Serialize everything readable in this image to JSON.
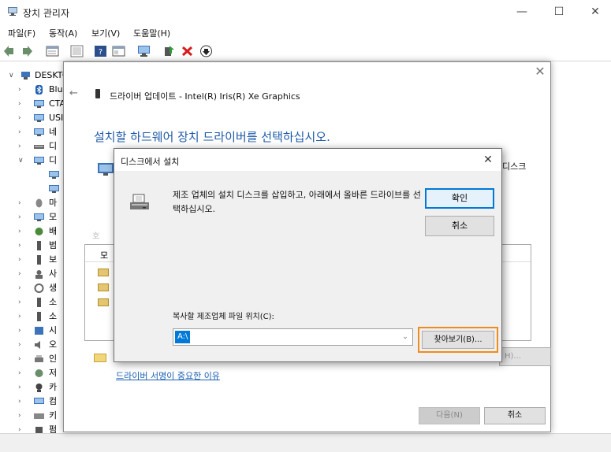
{
  "window": {
    "title": "장치 관리자",
    "controls": {
      "minimize": "—",
      "maximize": "☐",
      "close": "✕"
    }
  },
  "menu": [
    "파일(F)",
    "동작(A)",
    "보기(V)",
    "도움말(H)"
  ],
  "toolbar": [
    "back-icon",
    "forward-icon",
    "properties-icon",
    "view-icon",
    "help-icon",
    "view2-icon",
    "monitor-icon",
    "update-driver-icon",
    "uninstall-icon",
    "download-icon"
  ],
  "tree": {
    "root": "DESKTC",
    "items": [
      "Blu",
      "CTA",
      "USI",
      "네",
      "디",
      "디",
      "",
      "",
      "마",
      "모",
      "배",
      "범",
      "보",
      "사",
      "생",
      "소",
      "소",
      "시",
      "오",
      "인",
      "저",
      "카",
      "컴",
      "키",
      "펌"
    ]
  },
  "wizard": {
    "close": "✕",
    "back": "←",
    "title": "드라이버 업데이트 - Intel(R) Iris(R) Xe Graphics",
    "heading": "설치할 하드웨어 장치 드라이버를 선택하십시오.",
    "side_text": "디스크",
    "compat_text": "호",
    "list_header": "모",
    "have_disk": "H)...",
    "link": "드라이버 서명이 중요한 이유",
    "next": "다음(N)",
    "cancel": "취소"
  },
  "dialog": {
    "title": "디스크에서 설치",
    "close": "✕",
    "message": "제조 업체의 설치 디스크를 삽입하고, 아래에서 올바른 드라이브를 선택하십시오.",
    "ok": "확인",
    "cancel": "취소",
    "path_label": "복사할 제조업체 파일 위치(C):",
    "path_value": "A:\\",
    "browse": "찾아보기(B)..."
  },
  "colors": {
    "heading_blue": "#1e5aa8",
    "highlight_orange": "#f08c1c",
    "selection_blue": "#0078d7"
  }
}
